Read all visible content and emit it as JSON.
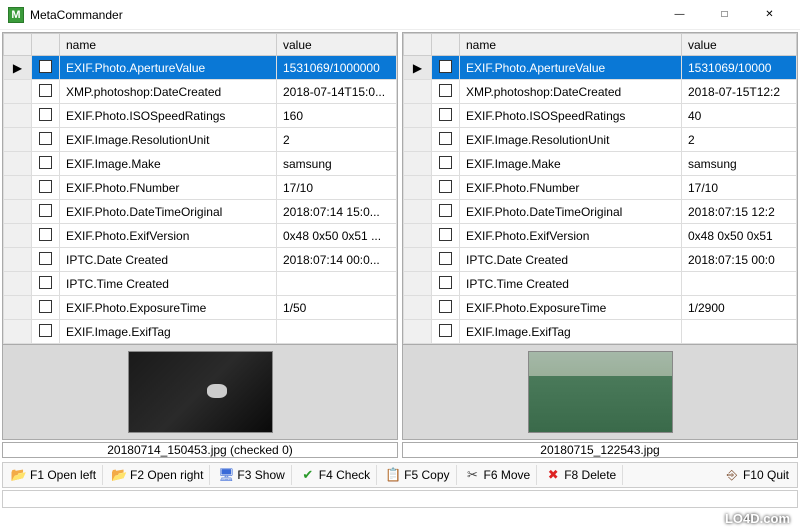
{
  "window": {
    "title": "MetaCommander",
    "icon_letter": "M"
  },
  "columns": {
    "name": "name",
    "value": "value"
  },
  "left": {
    "rows": [
      {
        "name": "EXIF.Photo.ApertureValue",
        "value": "1531069/1000000",
        "sel": true
      },
      {
        "name": "XMP.photoshop:DateCreated",
        "value": "2018-07-14T15:0..."
      },
      {
        "name": "EXIF.Photo.ISOSpeedRatings",
        "value": "160"
      },
      {
        "name": "EXIF.Image.ResolutionUnit",
        "value": "2"
      },
      {
        "name": "EXIF.Image.Make",
        "value": "samsung"
      },
      {
        "name": "EXIF.Photo.FNumber",
        "value": "17/10"
      },
      {
        "name": "EXIF.Photo.DateTimeOriginal",
        "value": "2018:07:14 15:0..."
      },
      {
        "name": "EXIF.Photo.ExifVersion",
        "value": "0x48 0x50 0x51 ..."
      },
      {
        "name": "IPTC.Date Created",
        "value": "2018:07:14 00:0..."
      },
      {
        "name": "IPTC.Time Created",
        "value": ""
      },
      {
        "name": "EXIF.Photo.ExposureTime",
        "value": "1/50"
      },
      {
        "name": "EXIF.Image.ExifTag",
        "value": ""
      }
    ],
    "filename": "20180714_150453.jpg (checked 0)"
  },
  "right": {
    "rows": [
      {
        "name": "EXIF.Photo.ApertureValue",
        "value": "1531069/10000",
        "sel": true
      },
      {
        "name": "XMP.photoshop:DateCreated",
        "value": "2018-07-15T12:2"
      },
      {
        "name": "EXIF.Photo.ISOSpeedRatings",
        "value": "40"
      },
      {
        "name": "EXIF.Image.ResolutionUnit",
        "value": "2"
      },
      {
        "name": "EXIF.Image.Make",
        "value": "samsung"
      },
      {
        "name": "EXIF.Photo.FNumber",
        "value": "17/10"
      },
      {
        "name": "EXIF.Photo.DateTimeOriginal",
        "value": "2018:07:15 12:2"
      },
      {
        "name": "EXIF.Photo.ExifVersion",
        "value": "0x48 0x50 0x51"
      },
      {
        "name": "IPTC.Date Created",
        "value": "2018:07:15 00:0"
      },
      {
        "name": "IPTC.Time Created",
        "value": ""
      },
      {
        "name": "EXIF.Photo.ExposureTime",
        "value": "1/2900"
      },
      {
        "name": "EXIF.Image.ExifTag",
        "value": ""
      }
    ],
    "filename": "20180715_122543.jpg"
  },
  "toolbar": {
    "open_left": "F1 Open left",
    "open_right": "F2 Open right",
    "show": "F3 Show",
    "check": "F4 Check",
    "copy": "F5 Copy",
    "move": "F6 Move",
    "delete": "F8 Delete",
    "quit": "F10 Quit"
  },
  "watermark": "LO4D.com"
}
